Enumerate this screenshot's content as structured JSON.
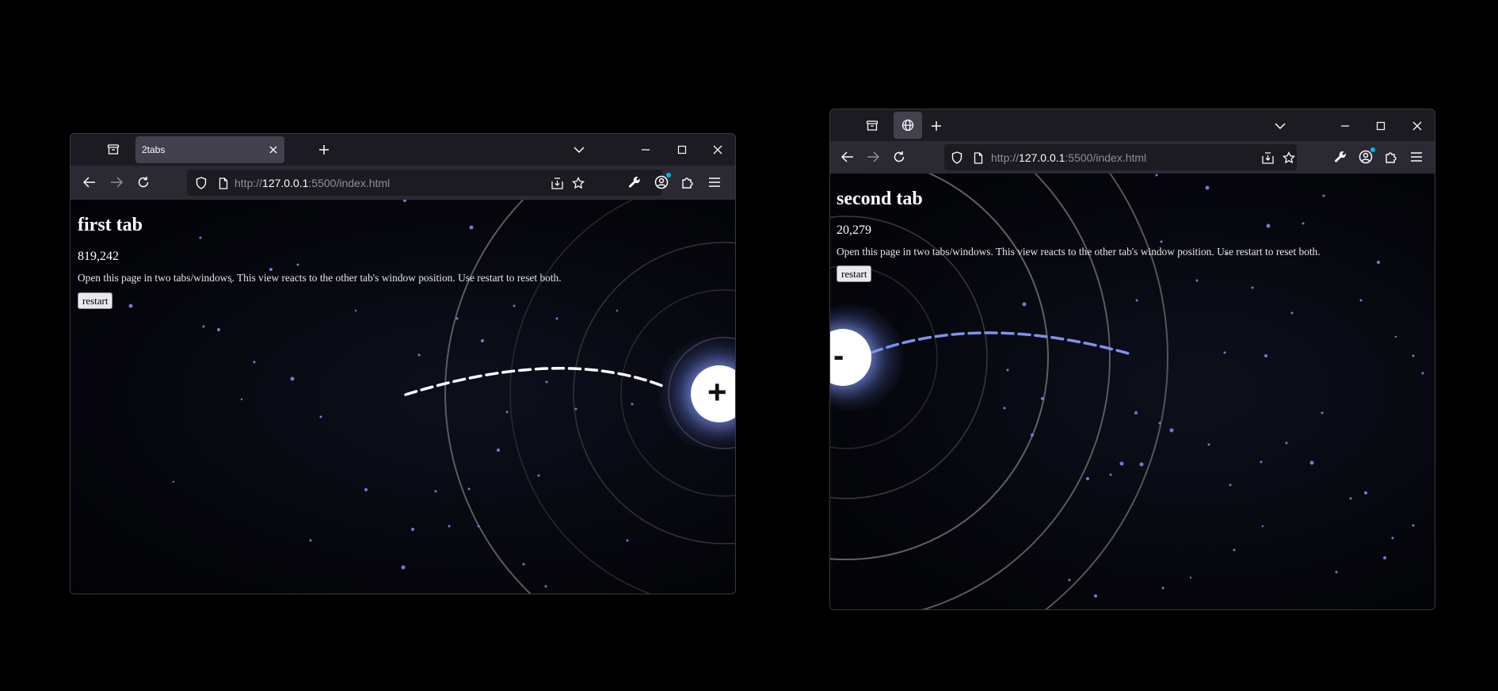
{
  "window1": {
    "tab": {
      "title": "2tabs"
    },
    "url": {
      "prefix": "http://",
      "host": "127.0.0.1",
      "suffix": ":5500/index.html"
    },
    "page": {
      "heading": "first tab",
      "counter": "819,242",
      "description": "Open this page in two tabs/windows. This view reacts to the other tab's window position. Use restart to reset both.",
      "restart_label": "restart",
      "orb_symbol": "+"
    }
  },
  "window2": {
    "tab": {
      "icon": "globe-icon"
    },
    "url": {
      "prefix": "http://",
      "host": "127.0.0.1",
      "suffix": ":5500/index.html"
    },
    "page": {
      "heading": "second tab",
      "counter": "20,279",
      "description": "Open this page in two tabs/windows. This view reacts to the other tab's window position. Use restart to reset both.",
      "restart_label": "restart",
      "orb_symbol": "-"
    }
  },
  "colors": {
    "desktop": "#000000",
    "chrome_dark": "#1c1b22",
    "toolbar": "#2b2a33",
    "accent": "#00b3f4",
    "beam_white": "#ffffff",
    "beam_blue": "#7b93ee"
  }
}
